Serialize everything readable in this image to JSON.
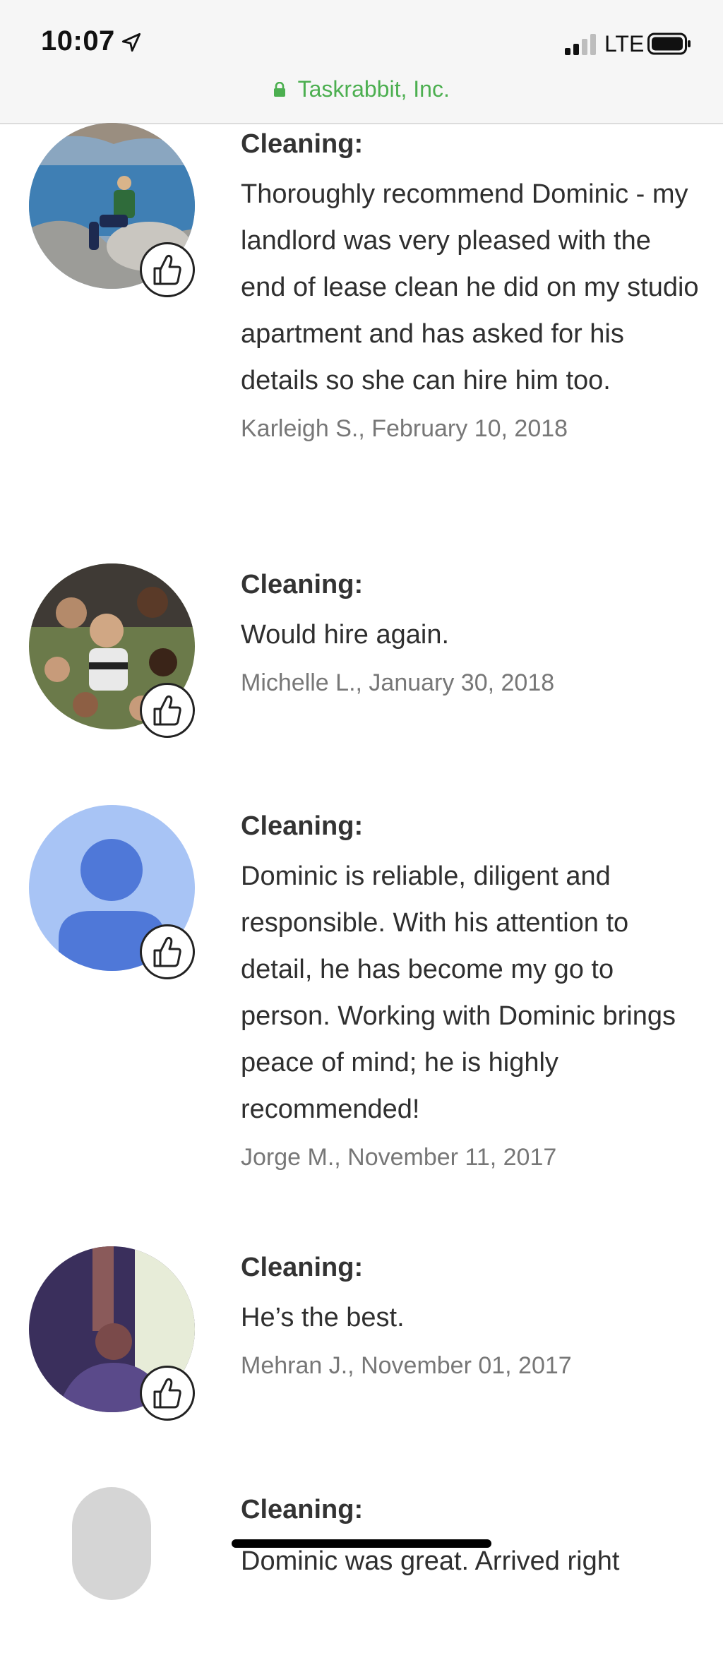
{
  "status_bar": {
    "time": "10:07",
    "network": "LTE"
  },
  "url_bar": {
    "domain": "Taskrabbit, Inc.",
    "secure_color": "#4caf50"
  },
  "reviews": [
    {
      "category": "Cleaning:",
      "text": "Thoroughly recommend Dominic - my landlord was very pleased with the end of lease clean he did on my studio apartment and has asked for his details so she can hire him too.",
      "author_date": "Karleigh S., February 10, 2018"
    },
    {
      "category": "Cleaning:",
      "text": "Would hire again.",
      "author_date": "Michelle L., January 30, 2018"
    },
    {
      "category": "Cleaning:",
      "text": "Dominic is reliable, diligent and responsible. With his attention to detail, he has become my go to person. Working with Dominic brings peace of mind; he is highly recommended!",
      "author_date": "Jorge M., November 11, 2017"
    },
    {
      "category": "Cleaning:",
      "text": "He’s the best.",
      "author_date": "Mehran J., November 01, 2017"
    },
    {
      "category": "Cleaning:",
      "text": "Dominic was great. Arrived right",
      "author_date": ""
    }
  ],
  "icons": {
    "thumbs_up": "thumbs-up-icon",
    "lock": "lock-icon",
    "location": "location-arrow-icon"
  }
}
